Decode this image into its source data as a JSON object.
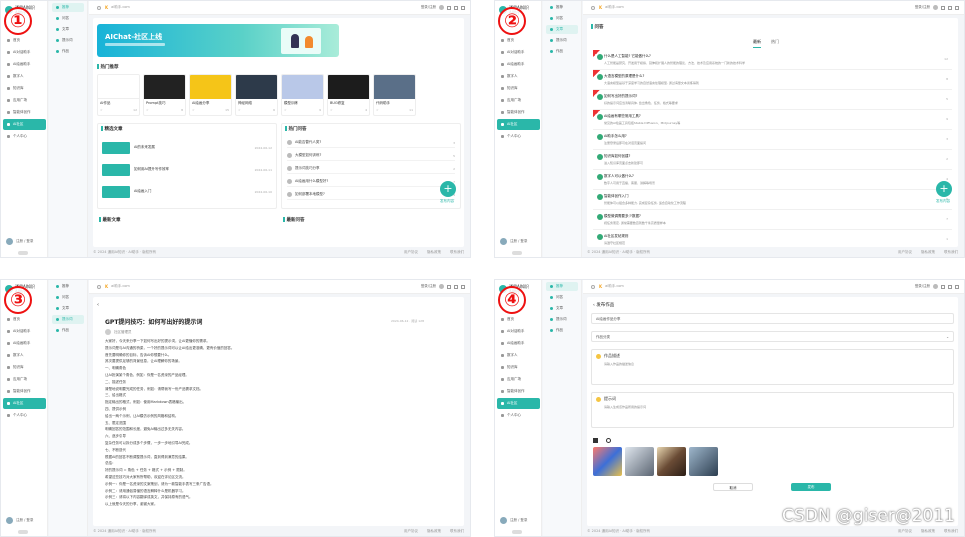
{
  "colors": {
    "accent": "#2ab7a9",
    "badge": "#e11111",
    "brand": "#f5a623"
  },
  "badges": [
    "①",
    "②",
    "③",
    "④"
  ],
  "app": {
    "title": "通用AI知识",
    "subtitle": "AI助手",
    "brand": "K",
    "topbar_text": "ai助手.com",
    "user_name": "注册 / 登录",
    "user_sub": "VIP会员"
  },
  "topbar_right": {
    "link": "登录/注册",
    "icons": [
      "avatar-icon",
      "settings-icon",
      "minimize-icon",
      "close-icon"
    ]
  },
  "menu": [
    {
      "label": "首页",
      "icon": "home-icon"
    },
    {
      "label": "AI对话助手",
      "icon": "chat-icon"
    },
    {
      "label": "AI绘画助手",
      "icon": "paint-icon"
    },
    {
      "label": "数字人",
      "icon": "person-icon"
    },
    {
      "label": "知识库",
      "icon": "book-icon"
    },
    {
      "label": "应用广场",
      "icon": "grid-icon"
    },
    {
      "label": "智能体创作",
      "icon": "robot-icon"
    },
    {
      "label": "AI社区",
      "icon": "community-icon",
      "active": true
    },
    {
      "label": "个人中心",
      "icon": "user-icon"
    }
  ],
  "submenu": [
    {
      "label": "推荐",
      "active": true
    },
    {
      "label": "问答"
    },
    {
      "label": "文章"
    },
    {
      "label": "提示词"
    },
    {
      "label": "作品"
    }
  ],
  "footer": {
    "copyright": "© 2024 通用AI知识 · AI助手 · 版权所有",
    "links": [
      "用户协议",
      "隐私政策",
      "联系我们"
    ]
  },
  "q1": {
    "banner_title": "AIChat-社区上线",
    "hot_title": "热门推荐",
    "cards": [
      {
        "label": "AI作品",
        "meta": "12"
      },
      {
        "label": "Prompt技巧",
        "meta": "8"
      },
      {
        "label": "AI绘画分享",
        "meta": "15"
      },
      {
        "label": "神经网络",
        "meta": "6"
      },
      {
        "label": "模型训练",
        "meta": "9"
      },
      {
        "label": "BUG修复",
        "meta": "4"
      },
      {
        "label": "代码助手",
        "meta": "11"
      }
    ],
    "article_title": "精选文章",
    "articles": [
      {
        "title": "AI的未来发展",
        "time": "2024-06-12"
      },
      {
        "title": "如何用AI提升写作效率",
        "time": "2024-06-11"
      },
      {
        "title": "AI绘画入门",
        "time": "2024-06-10"
      }
    ],
    "qa_title": "热门问答",
    "questions": [
      {
        "title": "AI能否替代人类?",
        "count": "3"
      },
      {
        "title": "大模型如何训练?",
        "count": "5"
      },
      {
        "title": "提示词技巧分享",
        "count": "2"
      },
      {
        "title": "AI绘画用什么模型好?",
        "count": "7"
      },
      {
        "title": "如何部署本地模型?",
        "count": "4"
      }
    ],
    "bottom_left": "最新文章",
    "bottom_right": "最新问答",
    "fab_label": "发布内容"
  },
  "q2": {
    "section_title": "问答",
    "tabs": [
      "最新",
      "热门"
    ],
    "items": [
      {
        "title": "什么是人工智能? 它能做什么?",
        "sub": "人工智能是研究、开发用于模拟、延伸和扩展人的智能的理论、方法、技术及应用系统的一门新的技术科学",
        "likes": "12",
        "ribbon": true
      },
      {
        "title": "大语言模型的原理是什么?",
        "sub": "大语言模型是基于深度学习的自然语言处理模型, 通过海量文本训练得到",
        "likes": "8",
        "ribbon": true
      },
      {
        "title": "如何写出好的提示词?",
        "sub": "好的提示词应当清晰具体, 给出角色、任务、格式等要求",
        "likes": "5",
        "ribbon": true
      },
      {
        "title": "AI绘画有哪些常用工具?",
        "sub": "常见的AI绘画工具包括Stable Diffusion、Midjourney等",
        "likes": "9",
        "ribbon": true
      },
      {
        "title": "AI助手怎么用?",
        "sub": "注册登录后即可在对话页面提问",
        "likes": "3"
      },
      {
        "title": "知识库如何创建?",
        "sub": "进入知识库页面点击新建即可",
        "likes": "2"
      },
      {
        "title": "数字人可以做什么?",
        "sub": "数字人可用于直播、客服、讲解等场景",
        "likes": "4"
      },
      {
        "title": "智能体创作入门",
        "sub": "智能体可以组合多种能力, 完成复杂任务, 适合自动化工作流程",
        "likes": "6"
      },
      {
        "title": "模型微调需要多少数据?",
        "sub": "视任务而定, 通常需要数百到数千条高质量样本",
        "likes": "7"
      },
      {
        "title": "AI社区发帖规则",
        "sub": "请遵守社区规范",
        "likes": "1"
      }
    ],
    "fab_label": "发布内容"
  },
  "q3": {
    "title": "GPT提问技巧：如何写出好的提示词",
    "meta": "2024-06-12 · 阅读 128",
    "author": "社区管理员",
    "lines": [
      "大家好，今天来分享一下如何写出好的提示词，让AI更懂你的需求。",
      "提示词是与AI沟通的桥梁，一个好的提示词可以让AI给出更准确、更有价值的回答。",
      "首先要明确你的目标，告诉AI你想要什么。",
      "其次要提供足够的背景信息，让AI理解你的场景。",
      "一、明确角色",
      "让AI扮演某个角色，例如：你是一名资深的产品经理。",
      "二、描述任务",
      "清楚地说明要完成的任务，例如：请帮我写一份产品需求文档。",
      "三、给出格式",
      "指定输出的格式，例如：使用Markdown表格输出。",
      "四、提供示例",
      "给出一两个示例，让AI模仿示例的风格和结构。",
      "五、限定范围",
      "明确回答的范围和长度，避免AI输出过多无关内容。",
      "六、逐步引导",
      "复杂任务可以拆分成多个步骤，一步一步地引导AI完成。",
      "七、不断迭代",
      "根据AI的回答不断调整提示词，直到得到满意的结果。",
      "总结：",
      "好的提示词 = 角色 + 任务 + 格式 + 示例 + 限制。",
      "希望这些技巧对大家有所帮助，欢迎在评论区交流。",
      "示例一：你是一名资深的文案策划，请为一款智能手表写三条广告语。",
      "示例二：请用通俗易懂的语言解释什么是机器学习。",
      "示例三：请将以下内容翻译成英文，并保持原有的语气。",
      "以上就是今天的分享，谢谢大家。"
    ]
  },
  "q4": {
    "form_title": "发布作品",
    "field1_value": "AI绘画作品分享",
    "field2_value": "作品分类",
    "box1_title": "作品描述",
    "box1_hint": "请输入作品的描述信息",
    "box2_title": "提示词",
    "box2_hint": "请输入生成该作品所用的提示词",
    "cancel": "取消",
    "submit": "发布"
  },
  "watermark": "CSDN @giser@2011"
}
